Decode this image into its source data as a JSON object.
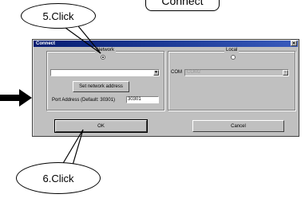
{
  "callouts": {
    "header": "Connect",
    "step5": "5.Click",
    "step6": "6.Click"
  },
  "dialog": {
    "title": "Connect",
    "close_glyph": "×",
    "network": {
      "legend": "Network",
      "radio_selected": true,
      "combo_value": "",
      "set_address_button": "Set network address",
      "port_label": "Port Address (Default: 30301)",
      "port_value": "30301"
    },
    "local": {
      "legend": "Local",
      "radio_selected": false,
      "com_label": "COM",
      "com_value": "COM2"
    },
    "ok_button": "OK",
    "cancel_button": "Cancel"
  },
  "icons": {
    "combo_arrow": "▼",
    "left_arrow": "arrow-right-icon"
  },
  "colors": {
    "titlebar": "#071d72",
    "window_face": "#c0c0c0"
  }
}
